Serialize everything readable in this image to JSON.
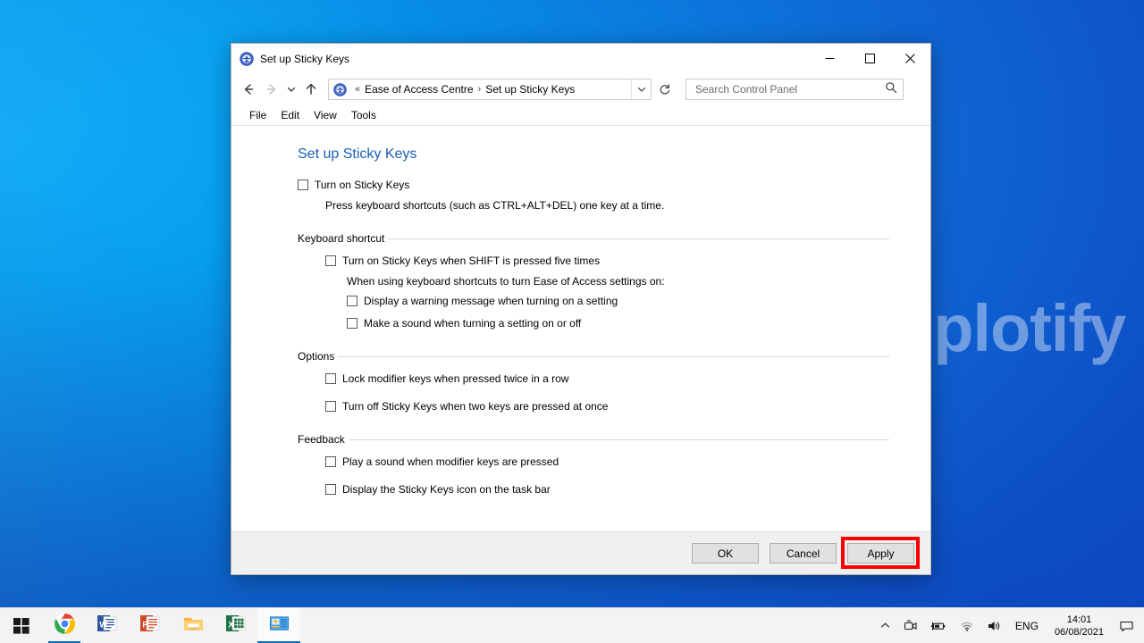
{
  "window": {
    "title": "Set up Sticky Keys",
    "title_icon": "ease-of-access-icon",
    "controls": {
      "minimize": "minimize-icon",
      "maximize": "maximize-icon",
      "close": "close-icon"
    }
  },
  "navigation": {
    "back": "back-arrow-icon",
    "forward": "forward-arrow-icon",
    "recent": "chevron-down-icon",
    "up": "up-arrow-icon",
    "address_icon": "ease-of-access-icon",
    "overflow": "«",
    "crumbs": [
      "Ease of Access Centre",
      "Set up Sticky Keys"
    ],
    "separator": "›",
    "dropdown": "chevron-down-icon",
    "refresh": "refresh-icon"
  },
  "search": {
    "placeholder": "Search Control Panel",
    "value": "",
    "icon": "search-icon"
  },
  "menubar": {
    "items": [
      "File",
      "Edit",
      "View",
      "Tools"
    ]
  },
  "main": {
    "page_title": "Set up Sticky Keys",
    "page_title_color": "#1a5fb4",
    "master": {
      "label": "Turn on Sticky Keys",
      "checked": false
    },
    "master_description": "Press keyboard shortcuts (such as CTRL+ALT+DEL) one key at a time.",
    "sections": [
      {
        "header": "Keyboard shortcut",
        "items": [
          {
            "label": "Turn on Sticky Keys when SHIFT is pressed five times",
            "checked": false,
            "indent": 1
          }
        ],
        "note": "When using keyboard shortcuts to turn Ease of Access settings on:",
        "sub_items": [
          {
            "label": "Display a warning message when turning on a setting",
            "checked": false,
            "indent": 2
          },
          {
            "label": "Make a sound when turning a setting on or off",
            "checked": false,
            "indent": 2
          }
        ]
      },
      {
        "header": "Options",
        "items": [
          {
            "label": "Lock modifier keys when pressed twice in a row",
            "checked": false,
            "indent": 1
          },
          {
            "label": "Turn off Sticky Keys when two keys are pressed at once",
            "checked": false,
            "indent": 1
          }
        ]
      },
      {
        "header": "Feedback",
        "items": [
          {
            "label": "Play a sound when modifier keys are pressed",
            "checked": false,
            "indent": 1
          },
          {
            "label": "Display the Sticky Keys icon on the task bar",
            "checked": false,
            "indent": 1
          }
        ]
      }
    ]
  },
  "footer": {
    "ok": "OK",
    "cancel": "Cancel",
    "apply": "Apply",
    "highlight_color": "#fc0000",
    "highlight_target": "Apply"
  },
  "watermark": {
    "text": "uplotify"
  },
  "taskbar": {
    "start": "windows-start-icon",
    "items": [
      {
        "name": "chrome-icon",
        "label": "Google Chrome",
        "running": true,
        "active": false
      },
      {
        "name": "word-icon",
        "label": "Microsoft Word",
        "running": false,
        "active": false
      },
      {
        "name": "powerpoint-icon",
        "label": "Microsoft PowerPoint",
        "running": false,
        "active": false
      },
      {
        "name": "file-explorer-icon",
        "label": "File Explorer",
        "running": false,
        "active": false
      },
      {
        "name": "excel-icon",
        "label": "Microsoft Excel",
        "running": false,
        "active": false
      },
      {
        "name": "control-panel-icon",
        "label": "Control Panel",
        "running": true,
        "active": true
      }
    ],
    "tray": {
      "overflow": "chevron-up-icon",
      "icons": [
        "camera-icon",
        "battery-icon",
        "wifi-icon",
        "volume-icon"
      ],
      "language": "ENG",
      "time": "14:01",
      "date": "06/08/2021",
      "notifications": "notification-icon"
    }
  }
}
